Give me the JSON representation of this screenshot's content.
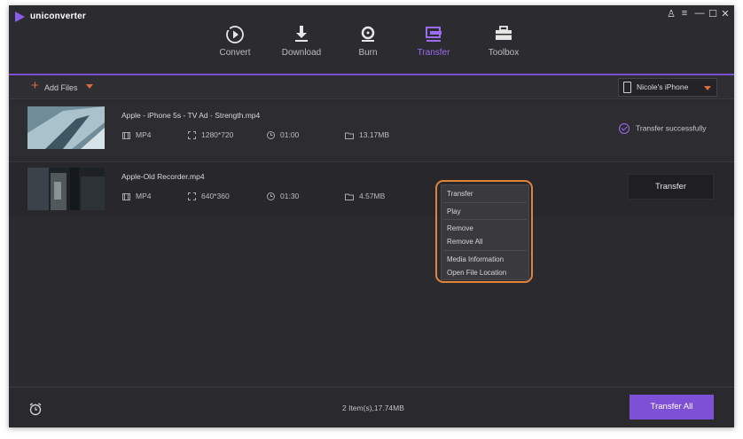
{
  "app": {
    "title": "uniconverter"
  },
  "window_controls": {
    "user": "♙",
    "menu": "≡",
    "minimize": "—",
    "maximize": "☐",
    "close": "✕"
  },
  "nav": [
    {
      "label": "Convert",
      "icon": "convert-icon",
      "active": false
    },
    {
      "label": "Download",
      "icon": "download-icon",
      "active": false
    },
    {
      "label": "Burn",
      "icon": "burn-icon",
      "active": false
    },
    {
      "label": "Transfer",
      "icon": "transfer-icon",
      "active": true
    },
    {
      "label": "Toolbox",
      "icon": "toolbox-icon",
      "active": false
    }
  ],
  "toolbar": {
    "add_files": "Add Files",
    "device": "Nicole's iPhone"
  },
  "files": [
    {
      "name": "Apple - iPhone 5s - TV Ad - Strength.mp4",
      "format": "MP4",
      "resolution": "1280*720",
      "duration": "01:00",
      "size": "13.17MB",
      "status": "Transfer successfully"
    },
    {
      "name": "Apple-Old Recorder.mp4",
      "format": "MP4",
      "resolution": "640*360",
      "duration": "01:30",
      "size": "4.57MB",
      "action": "Transfer"
    }
  ],
  "context_menu": {
    "items": [
      "Transfer",
      "Play",
      "Remove",
      "Remove All",
      "Media Information",
      "Open File Location"
    ]
  },
  "footer": {
    "summary": "2 Item(s),17.74MB",
    "transfer_all": "Transfer All"
  },
  "colors": {
    "accent": "#7d50d6",
    "orange": "#e0843c",
    "background": "#2b2a2f"
  }
}
